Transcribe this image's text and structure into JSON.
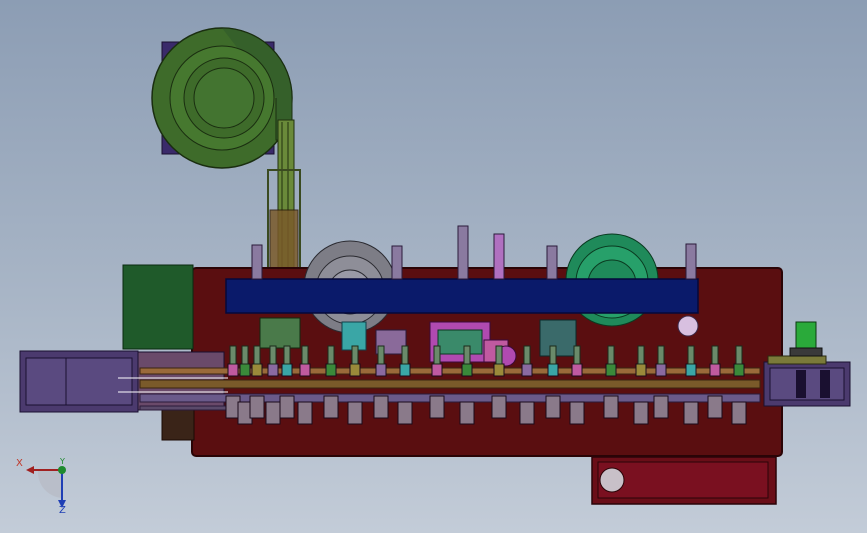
{
  "viewport": {
    "background_top": "#8c9db4",
    "background_bottom": "#c3ccd8"
  },
  "colors": {
    "plate": "#5a0e10",
    "plate_edge": "#2a0406",
    "feeder_bowl": "#3e6b2a",
    "feeder_bowl_dark": "#24401a",
    "bowl_base": "#3a2a6a",
    "cover_bar": "#0a1a6a",
    "motor_box": "#1f5a2a",
    "grey_bowl": "#7d7d86",
    "teal_bowl": "#1f8a5a",
    "conveyor": "#4b3a6e",
    "rail": "#9a9a3a",
    "drawer": "#6a0e18"
  },
  "triad": {
    "x_label": "X",
    "y_label": "Y",
    "z_label": "Z"
  }
}
